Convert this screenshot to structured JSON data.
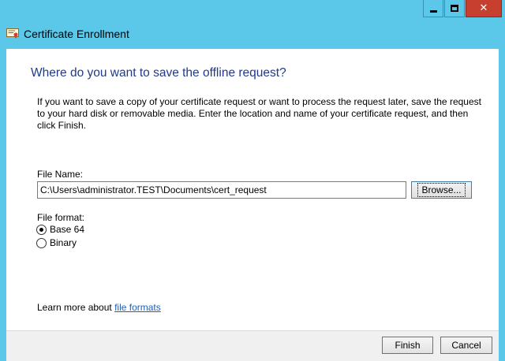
{
  "window": {
    "title": "Certificate Enrollment",
    "icon": "certificate-icon",
    "caption_buttons": {
      "minimize": "minimize-icon",
      "maximize": "maximize-icon",
      "close": "close-icon",
      "close_glyph": "✕"
    }
  },
  "page": {
    "heading": "Where do you want to save the offline request?",
    "description": "If you want to save a copy of your certificate request or want to process the request later, save the request to your hard disk or removable media. Enter the location and name of your certificate request, and then click Finish."
  },
  "file_name": {
    "label": "File Name:",
    "value": "C:\\Users\\administrator.TEST\\Documents\\cert_request",
    "browse_label": "Browse..."
  },
  "file_format": {
    "label": "File format:",
    "options": [
      {
        "label": "Base 64",
        "selected": true
      },
      {
        "label": "Binary",
        "selected": false
      }
    ]
  },
  "learn_more": {
    "text": "Learn more about ",
    "link": "file formats"
  },
  "footer": {
    "finish_label": "Finish",
    "cancel_label": "Cancel"
  },
  "colors": {
    "frame": "#5bc8ea",
    "close_button": "#c7402f",
    "heading": "#1f3a8a",
    "link": "#1f5fb4"
  }
}
